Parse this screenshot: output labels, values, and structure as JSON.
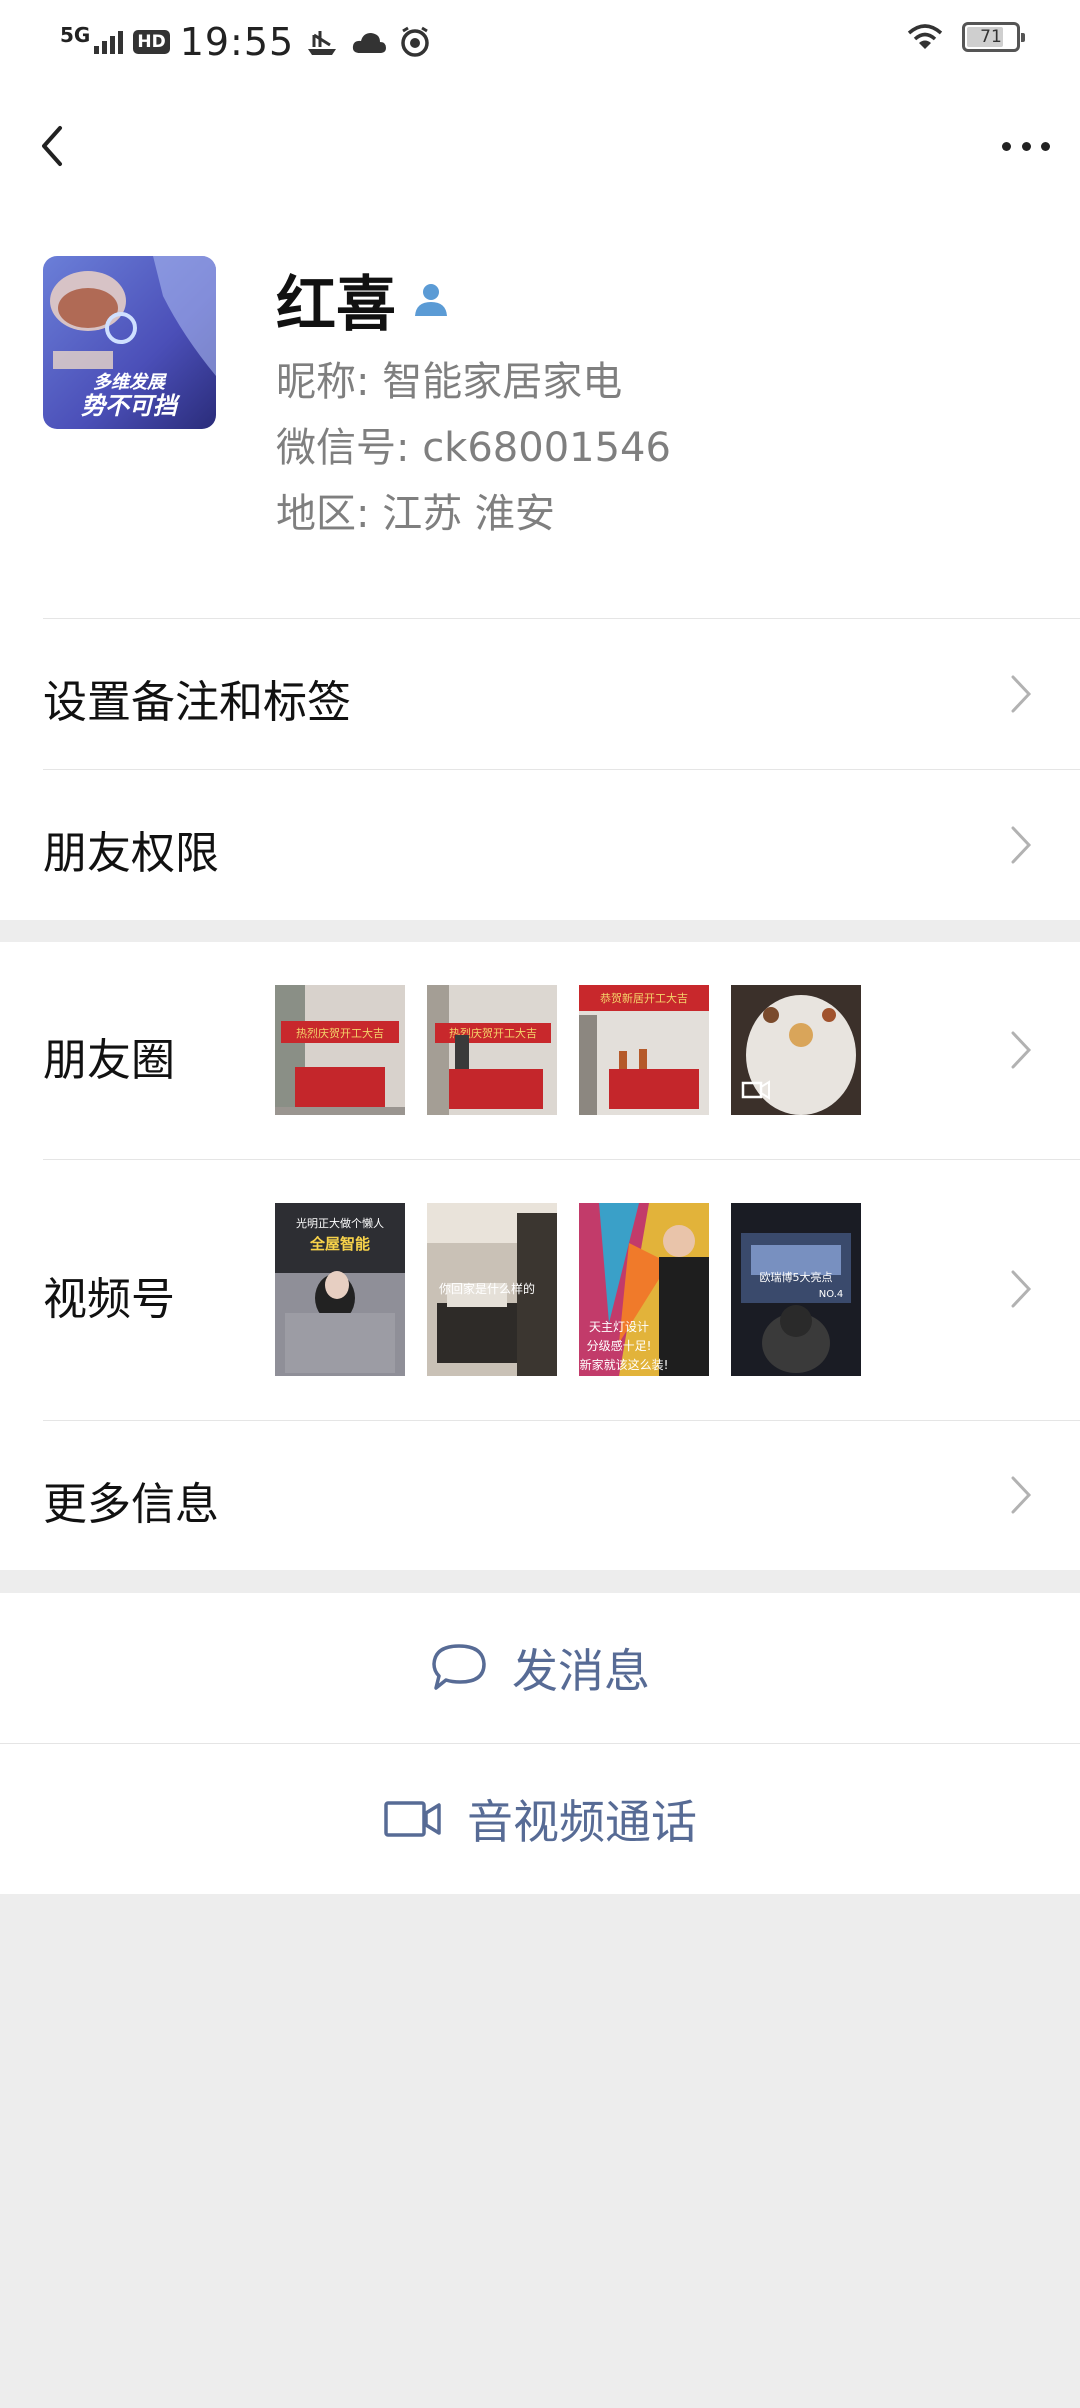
{
  "status_bar": {
    "network": "5G",
    "hd": "HD",
    "time": "19:55",
    "battery": "71",
    "battery_level_percent": 71
  },
  "nav": {
    "back_icon": "chevron-left-icon",
    "more_icon": "more-dots-icon"
  },
  "profile": {
    "name": "红喜",
    "verified_icon": "person-badge-icon",
    "avatar_text_line1": "多维发展",
    "avatar_text_line2": "势不可挡",
    "nickname": "昵称:  智能家居家电",
    "wechat_id": "微信号:  ck68001546",
    "region": "地区:  江苏  淮安"
  },
  "menu": {
    "remark_label": "设置备注和标签",
    "permission_label": "朋友权限",
    "moments_label": "朋友圈",
    "channels_label": "视频号",
    "more_info_label": "更多信息"
  },
  "moments_thumbs": [
    {
      "caption": "热烈庆贺开工大吉"
    },
    {
      "caption": "热烈庆贺开工大吉"
    },
    {
      "caption": "恭贺新居开工大吉"
    },
    {
      "caption": ""
    }
  ],
  "channels_thumbs": [
    {
      "caption1": "光明正大做个懒人",
      "caption2": "全屋智能"
    },
    {
      "caption1": "你回家是什么样的",
      "caption2": ""
    },
    {
      "caption1": "天主灯设计",
      "caption2": "分级感十足!",
      "caption3": "新家就该这么装!"
    },
    {
      "caption1": "欧瑞博5大亮点",
      "caption2": "NO.4"
    }
  ],
  "actions": {
    "message_label": "发消息",
    "call_label": "音视频通话"
  },
  "colors": {
    "accent": "#576b95",
    "background": "#ededed",
    "verified": "#5b9bd5"
  }
}
